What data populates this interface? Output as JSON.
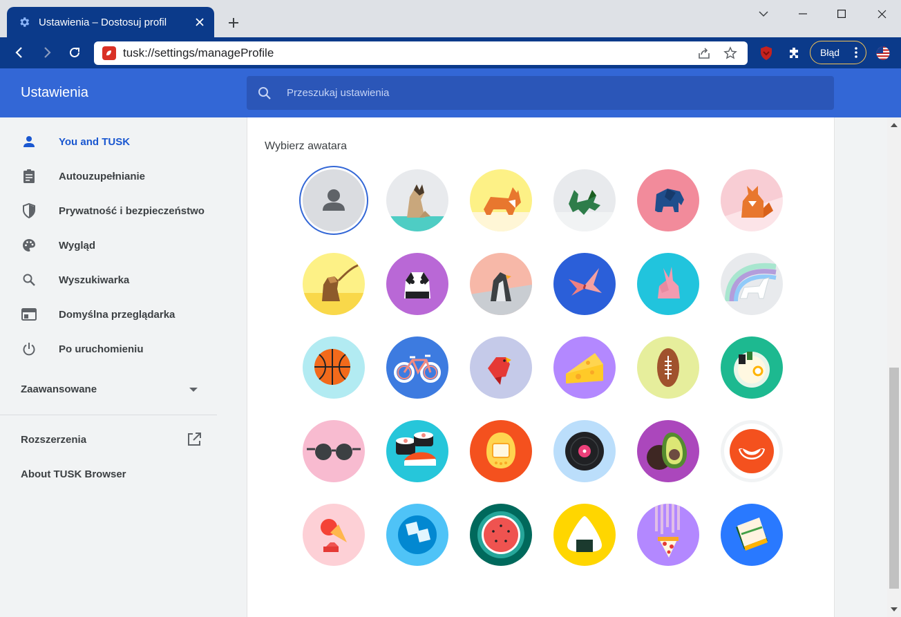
{
  "tab": {
    "title": "Ustawienia – Dostosuj profil"
  },
  "omnibox": {
    "url": "tusk://settings/manageProfile"
  },
  "toolbar": {
    "error_label": "Błąd"
  },
  "settings": {
    "title": "Ustawienia",
    "search_placeholder": "Przeszukaj ustawienia"
  },
  "sidebar": {
    "items": [
      {
        "label": "You and TUSK",
        "icon": "person-icon",
        "active": true
      },
      {
        "label": "Autouzupełnianie",
        "icon": "clipboard-icon",
        "active": false
      },
      {
        "label": "Prywatność i bezpieczeństwo",
        "icon": "shield-icon",
        "active": false
      },
      {
        "label": "Wygląd",
        "icon": "palette-icon",
        "active": false
      },
      {
        "label": "Wyszukiwarka",
        "icon": "search-icon",
        "active": false
      },
      {
        "label": "Domyślna przeglądarka",
        "icon": "browser-window-icon",
        "active": false
      },
      {
        "label": "Po uruchomieniu",
        "icon": "power-icon",
        "active": false
      }
    ],
    "advanced": "Zaawansowane",
    "extensions": "Rozszerzenia",
    "about": "About TUSK Browser"
  },
  "avatars": {
    "title": "Wybierz awatara",
    "items": [
      "default-person-avatar",
      "cat-avatar",
      "corgi-avatar",
      "dragon-avatar",
      "elephant-avatar",
      "fox-avatar",
      "monkey-avatar",
      "panda-avatar",
      "penguin-avatar",
      "butterfly-avatar",
      "rabbit-avatar",
      "unicorn-avatar",
      "basketball-avatar",
      "bicycle-avatar",
      "bird-avatar",
      "cheese-avatar",
      "football-avatar",
      "ramen-avatar",
      "sunglasses-avatar",
      "sushi-avatar",
      "tamagotchi-avatar",
      "vinyl-avatar",
      "avocado-avatar",
      "smiley-avatar",
      "ice-cream-avatar",
      "ice-cubes-avatar",
      "watermelon-avatar",
      "onigiri-avatar",
      "pizza-avatar",
      "sandwich-avatar"
    ],
    "selected_index": 0
  },
  "colors": {
    "tab_bg": "#0b3a8a",
    "header_bg": "#3367d6",
    "search_bg": "#2b56b8",
    "active_nav": "#1a57d0"
  }
}
